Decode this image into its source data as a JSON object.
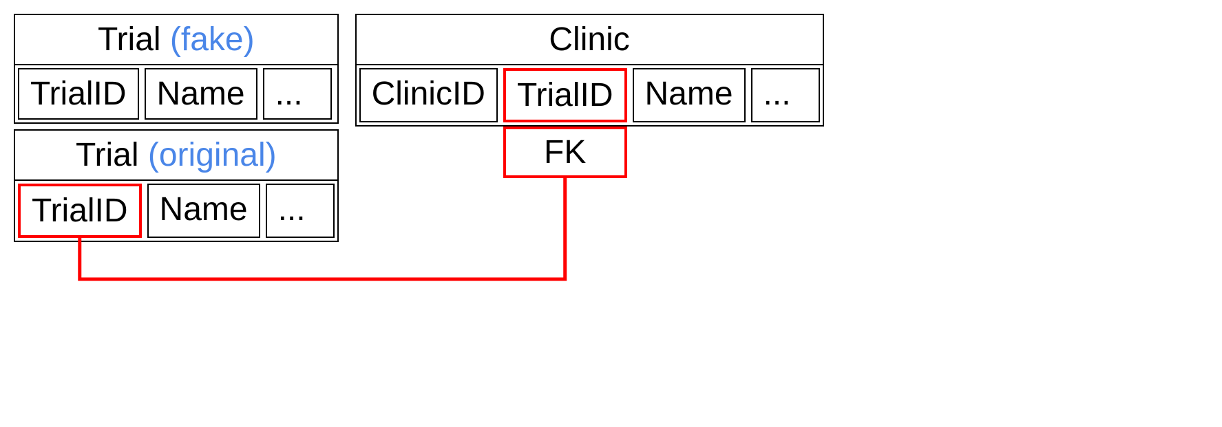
{
  "tables": {
    "trial_fake": {
      "name": "Trial",
      "annotation": "(fake)",
      "columns": [
        "TrialID",
        "Name",
        "..."
      ]
    },
    "trial_original": {
      "name": "Trial",
      "annotation": "(original)",
      "columns": [
        "TrialID",
        "Name",
        "..."
      ]
    },
    "clinic": {
      "name": "Clinic",
      "columns": [
        "ClinicID",
        "TrialID",
        "Name",
        "..."
      ]
    }
  },
  "fk_label": "FK",
  "relationships": [
    {
      "from_table": "clinic",
      "from_column": "TrialID",
      "to_table": "trial_original",
      "to_column": "TrialID",
      "type": "foreign_key"
    }
  ],
  "colors": {
    "highlight": "#ff0000",
    "annotation": "#4a86e8"
  }
}
